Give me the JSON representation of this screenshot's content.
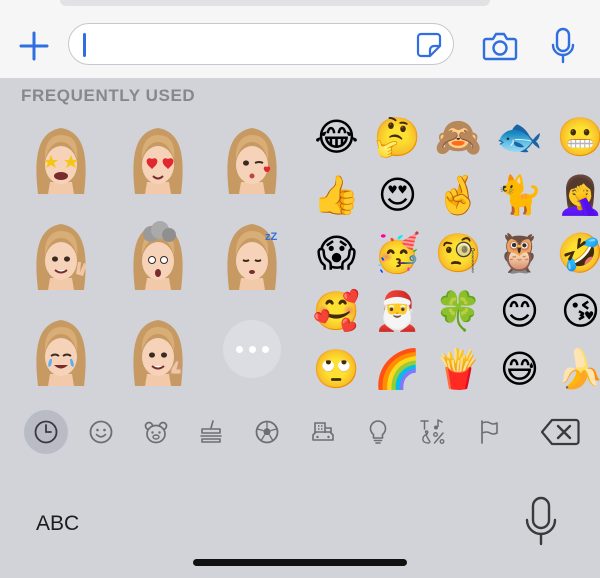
{
  "input_bar": {
    "add_icon": "plus-icon",
    "message_value": "",
    "sticker_icon": "sticker-icon",
    "camera_icon": "camera-icon",
    "mic_icon": "microphone-icon",
    "accent_color": "#2f6fe0"
  },
  "emoji_keyboard": {
    "section_title": "FREQUENTLY USED",
    "memoji": [
      {
        "name": "memoji-star-struck"
      },
      {
        "name": "memoji-heart-eyes"
      },
      {
        "name": "memoji-wink-kiss"
      },
      {
        "name": "memoji-peace-sign"
      },
      {
        "name": "memoji-mind-blown"
      },
      {
        "name": "memoji-sleeping"
      },
      {
        "name": "memoji-tears-of-joy"
      },
      {
        "name": "memoji-thumbs-up"
      }
    ],
    "more_icon": "more-dots-icon",
    "emojis": [
      "😂",
      "🤔",
      "🙈",
      "🐟",
      "😬",
      "👍",
      "😍",
      "🤞",
      "🐈",
      "🤦‍♀️",
      "😱",
      "🥳",
      "🧐",
      "🦉",
      "🤣",
      "🥰",
      "🎅",
      "🍀",
      "😊",
      "😘",
      "🙄",
      "🌈",
      "🍟",
      "😅",
      "🍌"
    ],
    "categories": [
      {
        "name": "recent-icon",
        "active": true
      },
      {
        "name": "smileys-icon"
      },
      {
        "name": "animals-icon"
      },
      {
        "name": "food-icon"
      },
      {
        "name": "activity-icon"
      },
      {
        "name": "travel-icon"
      },
      {
        "name": "objects-icon"
      },
      {
        "name": "symbols-icon"
      },
      {
        "name": "flags-icon"
      }
    ],
    "backspace_icon": "backspace-icon",
    "abc_label": "ABC",
    "dictation_icon": "microphone-icon"
  }
}
